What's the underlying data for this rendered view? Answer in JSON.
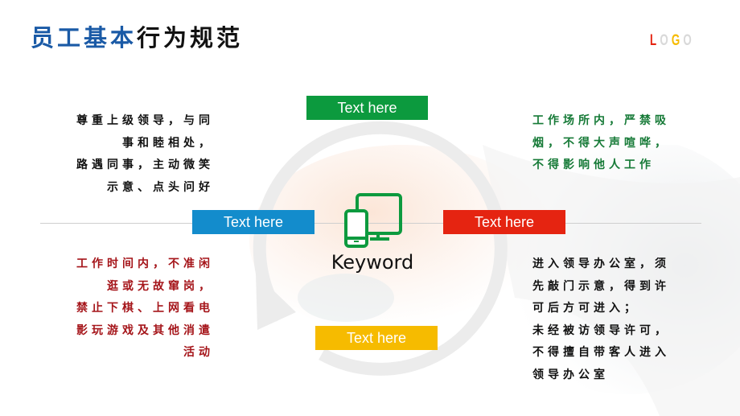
{
  "title": {
    "part1": "员工基本",
    "part2": "行为规范",
    "part1_color": "#1a5aa6",
    "part2_color": "#111111"
  },
  "logo": {
    "letters": [
      {
        "char": "L",
        "color": "#e52411"
      },
      {
        "char": "O",
        "color": "#d9d9d9"
      },
      {
        "char": "G",
        "color": "#f6bb00"
      },
      {
        "char": "O",
        "color": "#d9d9d9"
      }
    ]
  },
  "center": {
    "icon": "devices-icon",
    "keyword": "Keyword",
    "icon_color": "#0c9a3e"
  },
  "tags": {
    "top": {
      "label": "Text here",
      "color": "#0c9a3e"
    },
    "left": {
      "label": "Text here",
      "color": "#138ccc"
    },
    "right": {
      "label": "Text here",
      "color": "#e52411"
    },
    "bottom": {
      "label": "Text here",
      "color": "#f6bb00"
    }
  },
  "paragraphs": {
    "top_left": {
      "color": "#111111",
      "lines": [
        "尊重上级领导，与同",
        "事和睦相处，",
        "路遇同事，主动微笑",
        "示意、点头问好"
      ]
    },
    "top_right": {
      "color": "#167a37",
      "lines": [
        "工作场所内，严禁吸",
        "烟，不得大声喧哗，",
        "不得影响他人工作"
      ]
    },
    "bottom_left": {
      "color": "#a5151a",
      "lines": [
        "工作时间内，不准闲",
        "逛或无故窜岗，",
        "禁止下棋、上网看电",
        "影玩游戏及其他消遣",
        "活动"
      ]
    },
    "bottom_right": {
      "color": "#111111",
      "lines": [
        "进入领导办公室，须",
        "先敲门示意，得到许",
        "可后方可进入；",
        "未经被访领导许可，",
        "不得擅自带客人进入",
        "领导办公室"
      ]
    }
  }
}
